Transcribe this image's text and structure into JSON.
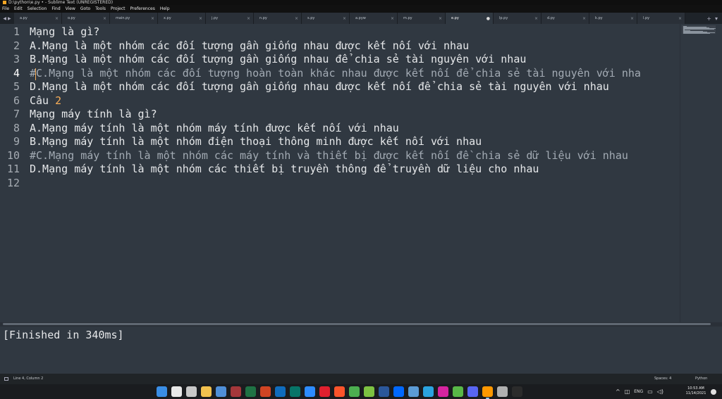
{
  "window": {
    "title": "D:\\python\\e.py • - Sublime Text (UNREGISTERED)"
  },
  "menu": [
    "File",
    "Edit",
    "Selection",
    "Find",
    "View",
    "Goto",
    "Tools",
    "Project",
    "Preferences",
    "Help"
  ],
  "tabs": [
    {
      "label": "a.py",
      "active": false
    },
    {
      "label": "o.py",
      "active": false
    },
    {
      "label": "main.py",
      "active": false
    },
    {
      "label": "x.py",
      "active": false
    },
    {
      "label": "j.py",
      "active": false
    },
    {
      "label": "n.py",
      "active": false
    },
    {
      "label": "s.py",
      "active": false
    },
    {
      "label": "a.pyw",
      "active": false
    },
    {
      "label": "m.py",
      "active": false
    },
    {
      "label": "e.py",
      "active": true
    },
    {
      "label": "lp.py",
      "active": false
    },
    {
      "label": "d.py",
      "active": false
    },
    {
      "label": "k.py",
      "active": false
    },
    {
      "label": "l.py",
      "active": false
    }
  ],
  "editor": {
    "current_line": 4,
    "lines": [
      {
        "n": "1",
        "text": "Mạng là gì?"
      },
      {
        "n": "2",
        "text": "A.Mạng là một nhóm các đối tượng gần giống nhau được kết nối với nhau"
      },
      {
        "n": "3",
        "text": "B.Mạng là một nhóm các đối tượng gần giống nhau để chia sẻ tài nguyên với nhau"
      },
      {
        "n": "4",
        "text": "#C.Mạng là một nhóm các đối tượng hoàn toàn khác nhau được kết nối để chia sẻ tài nguyên với nha"
      },
      {
        "n": "5",
        "text": "D.Mạng là một nhóm các đối tượng gần giống nhau được kết nối để chia sẻ tài nguyên với nhau"
      },
      {
        "n": "6",
        "text": "Câu ",
        "num": "2"
      },
      {
        "n": "7",
        "text": "Mạng máy tính là gì?"
      },
      {
        "n": "8",
        "text": "A.Mạng máy tính là một nhóm máy tính được kết nối với nhau"
      },
      {
        "n": "9",
        "text": "B.Mạng máy tính là một nhóm điện thoại thông minh được kết nối với nhau"
      },
      {
        "n": "10",
        "text": "#C.Mạng máy tính là một nhóm các máy tính và thiết bị được kết nối đề chia sẻ dữ liệu với nhau"
      },
      {
        "n": "11",
        "text": "D.Mạng máy tính là một nhóm các thiết bị truyền thông để truyền dữ liệu cho nhau"
      },
      {
        "n": "12",
        "text": ""
      }
    ]
  },
  "output": {
    "text": "[Finished in 340ms]"
  },
  "status": {
    "cursor": "Line 4, Column 2",
    "indent": "Spaces: 4",
    "syntax": "Python"
  },
  "taskbar": {
    "apps": [
      {
        "name": "start-icon",
        "color": "#3a8ee6"
      },
      {
        "name": "search-icon",
        "color": "#e8e8e8"
      },
      {
        "name": "task-view-icon",
        "color": "#c8c8c8"
      },
      {
        "name": "file-explorer-icon",
        "color": "#f2c14e"
      },
      {
        "name": "store-icon",
        "color": "#4f8fd8"
      },
      {
        "name": "access-icon",
        "color": "#a4373a"
      },
      {
        "name": "excel-icon",
        "color": "#1f7244"
      },
      {
        "name": "powerpoint-icon",
        "color": "#d04423"
      },
      {
        "name": "outlook-icon",
        "color": "#0f6cbd"
      },
      {
        "name": "publisher-icon",
        "color": "#077568"
      },
      {
        "name": "zoom-icon",
        "color": "#2d8cff"
      },
      {
        "name": "opera-icon",
        "color": "#e0202e"
      },
      {
        "name": "brave-icon",
        "color": "#fb542b"
      },
      {
        "name": "chrome-icon",
        "color": "#4caf50"
      },
      {
        "name": "app-green-icon",
        "color": "#7dc242"
      },
      {
        "name": "word-icon",
        "color": "#2b579a"
      },
      {
        "name": "zalo-icon",
        "color": "#0068ff"
      },
      {
        "name": "picture-icon",
        "color": "#5b9bd5"
      },
      {
        "name": "telegram-icon",
        "color": "#2aa3df"
      },
      {
        "name": "instagram-icon",
        "color": "#d6249f"
      },
      {
        "name": "camtasia-icon",
        "color": "#58b847"
      },
      {
        "name": "discord-icon",
        "color": "#5865f2"
      },
      {
        "name": "sublime-text-icon",
        "color": "#ff9800"
      },
      {
        "name": "snipping-tool-icon",
        "color": "#b0b0b0"
      },
      {
        "name": "terminal-icon",
        "color": "#2b2b2b"
      }
    ],
    "tray": {
      "lang": "ENG",
      "time": "10:53 AM",
      "date": "11/14/2021"
    }
  },
  "colors": {
    "editor_bg": "#303841",
    "accent": "#f9ae58",
    "comment": "#a3abb4",
    "text": "#e6e8ea"
  }
}
